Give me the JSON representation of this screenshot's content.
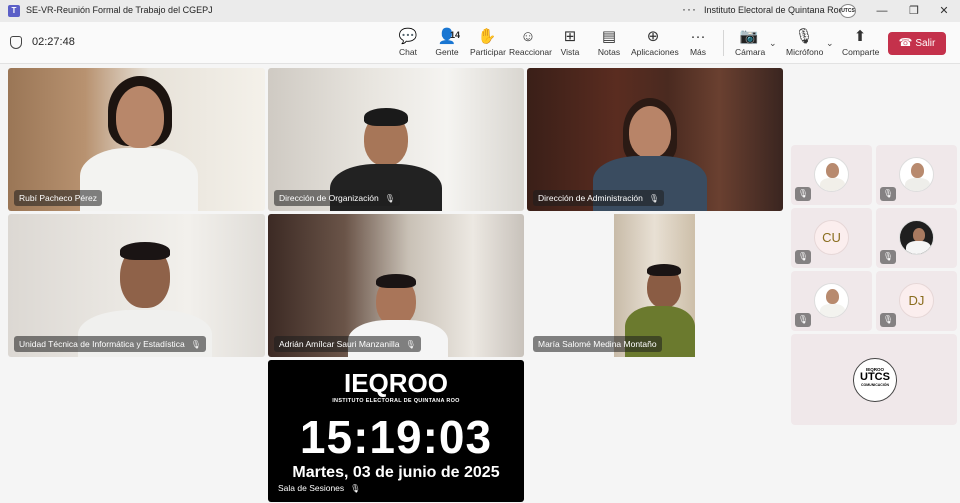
{
  "window": {
    "title": "SE-VR-Reunión Formal de Trabajo del CGEPJ",
    "organization": "Instituto Electoral de Quintana Roo",
    "org_badge": "UTCS",
    "more": "···",
    "minimize": "—",
    "maximize": "❐",
    "close": "✕"
  },
  "meeting": {
    "elapsed": "02:27:48",
    "participant_count": "14"
  },
  "toolbar": {
    "chat": "Chat",
    "people": "Gente",
    "raise": "Participar",
    "react": "Reaccionar",
    "view": "Vista",
    "notes": "Notas",
    "apps": "Aplicaciones",
    "more": "Más",
    "camera": "Cámara",
    "mic": "Micrófono",
    "share": "Comparte",
    "leave": "Salir"
  },
  "tiles": [
    {
      "name": "Rubí Pacheco Pérez"
    },
    {
      "name": "Dirección de Organización"
    },
    {
      "name": "Dirección de Administración"
    },
    {
      "name": "Unidad Técnica de Informática y Estadística"
    },
    {
      "name": "Adrián Amílcar Sauri Manzanilla"
    },
    {
      "name": "María Salomé Medina Montaño"
    }
  ],
  "clock_tile": {
    "logo": "IEQROO",
    "logo_sub": "INSTITUTO ELECTORAL DE QUINTANA ROO",
    "time": "15:19:03",
    "date": "Martes, 03 de junio de 2025",
    "name": "Sala de Sesiones"
  },
  "side_tiles": [
    {
      "initials": ""
    },
    {
      "initials": ""
    },
    {
      "initials": "CU"
    },
    {
      "initials": ""
    },
    {
      "initials": ""
    },
    {
      "initials": "DJ"
    }
  ],
  "utcs_tile": {
    "top": "IEQROO",
    "mid": "UTCS",
    "bot": "COMUNICACIÓN"
  },
  "colors": {
    "leave": "#c4314b",
    "teams": "#5b5fc7"
  },
  "icons": {
    "mic_off": "🎙"
  }
}
